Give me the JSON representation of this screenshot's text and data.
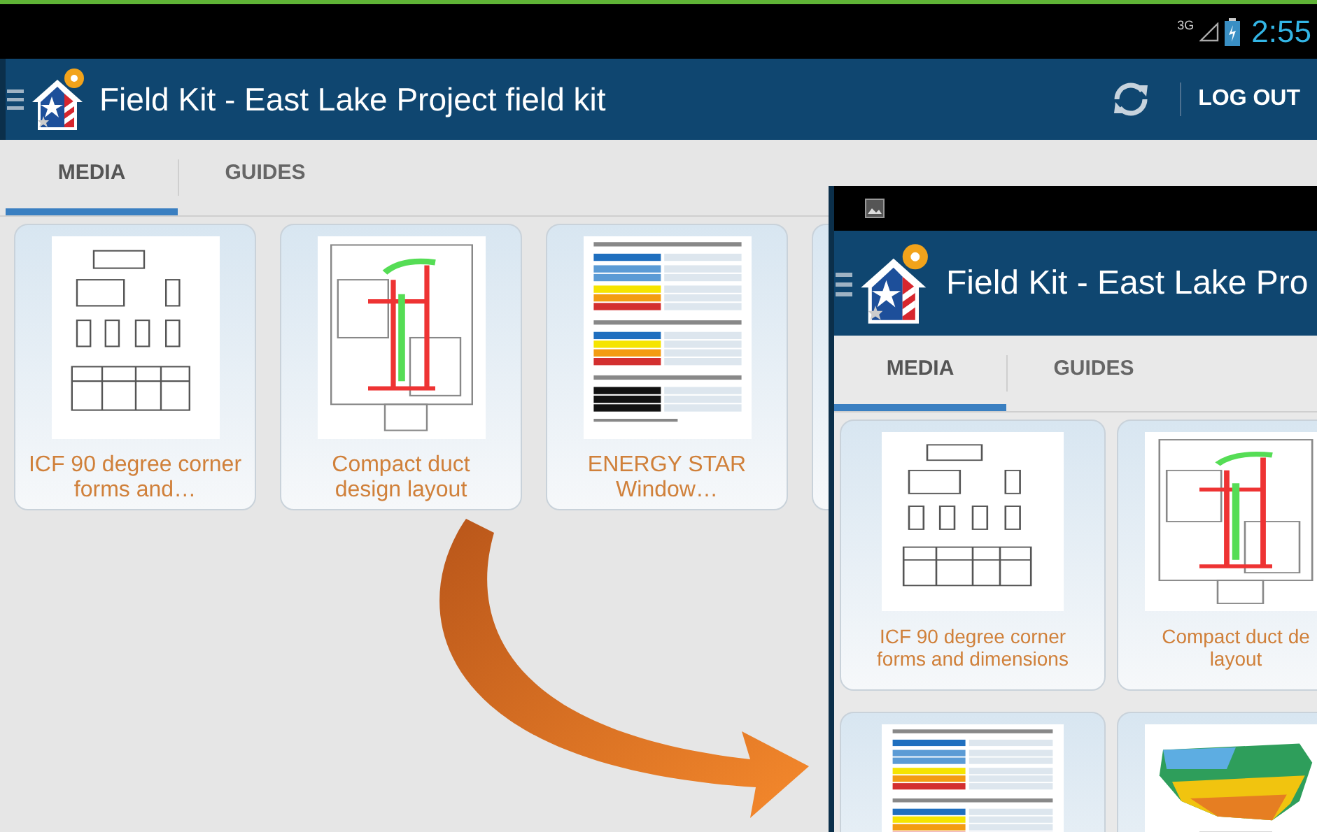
{
  "status_bar": {
    "network": "3G",
    "time": "2:55"
  },
  "app_bar": {
    "title": "Field Kit - East Lake Project field kit",
    "action": "LOG OUT"
  },
  "tabs": [
    {
      "label": "MEDIA",
      "selected": true
    },
    {
      "label": "GUIDES",
      "selected": false
    }
  ],
  "media": [
    {
      "kind": "drawing",
      "caption_lines": [
        "ICF 90 degree corner",
        "forms and…"
      ]
    },
    {
      "kind": "plan",
      "caption_lines": [
        "Compact duct",
        "design layout"
      ]
    },
    {
      "kind": "table",
      "caption_lines": [
        "ENERGY STAR",
        "Window…"
      ]
    }
  ],
  "inset": {
    "app_bar": {
      "title": "Field Kit - East Lake Pro"
    },
    "tabs": [
      {
        "label": "MEDIA",
        "selected": true
      },
      {
        "label": "GUIDES",
        "selected": false
      }
    ],
    "media": [
      {
        "kind": "drawing",
        "caption_lines": [
          "ICF 90 degree corner",
          "forms and dimensions"
        ]
      },
      {
        "kind": "plan",
        "caption_lines": [
          "Compact duct de",
          "layout"
        ]
      },
      {
        "kind": "table"
      },
      {
        "kind": "map"
      }
    ]
  }
}
